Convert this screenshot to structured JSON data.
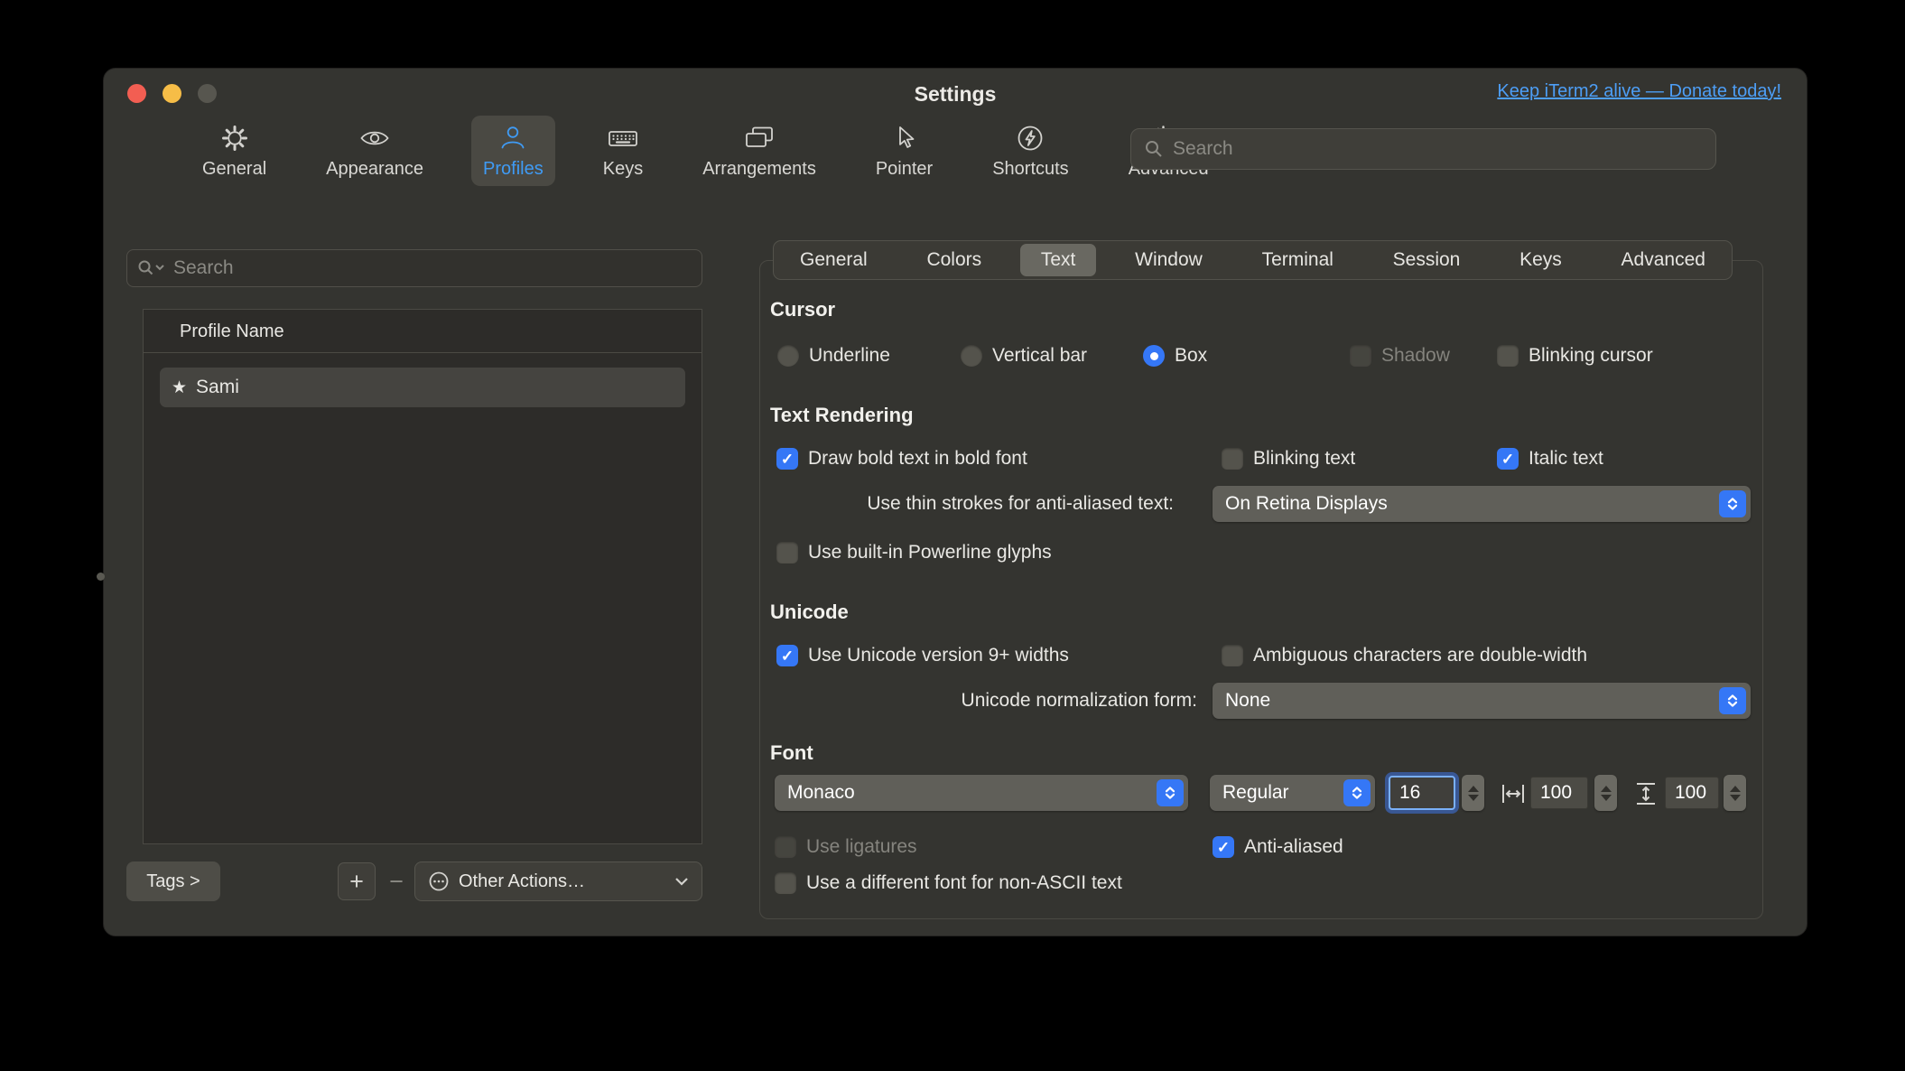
{
  "window": {
    "title": "Settings",
    "donate_link": "Keep iTerm2 alive — Donate today!"
  },
  "toolbar": {
    "search_placeholder": "Search",
    "items": [
      {
        "label": "General",
        "selected": false
      },
      {
        "label": "Appearance",
        "selected": false
      },
      {
        "label": "Profiles",
        "selected": true
      },
      {
        "label": "Keys",
        "selected": false
      },
      {
        "label": "Arrangements",
        "selected": false
      },
      {
        "label": "Pointer",
        "selected": false
      },
      {
        "label": "Shortcuts",
        "selected": false
      },
      {
        "label": "Advanced",
        "selected": false
      }
    ]
  },
  "sidebar": {
    "search_placeholder": "Search",
    "list_header": "Profile Name",
    "profiles": [
      {
        "name": "Sami",
        "starred": true
      }
    ],
    "tags_button": "Tags >",
    "add_button": "+",
    "remove_button": "−",
    "other_actions": "Other Actions…"
  },
  "tabs": {
    "items": [
      "General",
      "Colors",
      "Text",
      "Window",
      "Terminal",
      "Session",
      "Keys",
      "Advanced"
    ],
    "selected": "Text"
  },
  "panel": {
    "cursor": {
      "heading": "Cursor",
      "underline": "Underline",
      "vertical_bar": "Vertical bar",
      "box": "Box",
      "selected_radio": "Box",
      "shadow": "Shadow",
      "blinking_cursor": "Blinking cursor"
    },
    "text_rendering": {
      "heading": "Text Rendering",
      "draw_bold": "Draw bold text in bold font",
      "draw_bold_checked": true,
      "blinking_text": "Blinking text",
      "blinking_text_checked": false,
      "italic_text": "Italic text",
      "italic_text_checked": true,
      "thin_strokes_label": "Use thin strokes for anti-aliased text:",
      "thin_strokes_value": "On Retina Displays",
      "powerline": "Use built-in Powerline glyphs",
      "powerline_checked": false
    },
    "unicode": {
      "heading": "Unicode",
      "v9_widths": "Use Unicode version 9+ widths",
      "v9_widths_checked": true,
      "ambiguous": "Ambiguous characters are double-width",
      "ambiguous_checked": false,
      "norm_label": "Unicode normalization form:",
      "norm_value": "None"
    },
    "font": {
      "heading": "Font",
      "family": "Monaco",
      "style": "Regular",
      "size": "16",
      "h_spacing": "100",
      "v_spacing": "100",
      "ligatures": "Use ligatures",
      "ligatures_checked": false,
      "antialiased": "Anti-aliased",
      "antialiased_checked": true,
      "non_ascii": "Use a different font for non-ASCII text",
      "non_ascii_checked": false
    }
  }
}
